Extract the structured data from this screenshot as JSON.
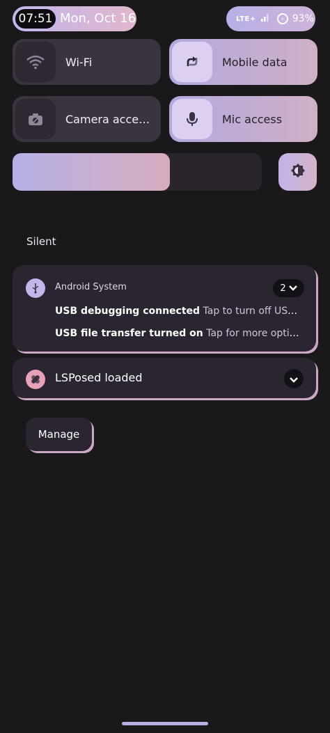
{
  "status_bar": {
    "time": "07:51",
    "date": "Mon, Oct 16",
    "network": "LTE+",
    "battery": "93%"
  },
  "tiles": {
    "wifi": {
      "label": "Wi-Fi",
      "icon": "wifi-icon",
      "active": false
    },
    "mobile_data": {
      "label": "Mobile data",
      "icon": "mobile-data-icon",
      "active": true
    },
    "camera_access": {
      "label": "Camera acce…",
      "icon": "camera-icon",
      "active": false
    },
    "mic_access": {
      "label": "Mic access",
      "icon": "mic-icon",
      "active": true
    }
  },
  "brightness": {
    "level": 0.63,
    "auto_icon": "brightness-auto-icon"
  },
  "section": {
    "title": "Silent"
  },
  "notifications": [
    {
      "app": "Android System",
      "count": "2",
      "icon": "usb-icon",
      "icon_color": "#c3b6ea",
      "lines": [
        {
          "title": "USB debugging connected",
          "text": "Tap to turn off USB deb…"
        },
        {
          "title": "USB file transfer turned on",
          "text": "Tap for more options."
        }
      ]
    },
    {
      "title": "LSPosed loaded",
      "icon": "lsposed-icon",
      "icon_color": "#e7a2b8"
    }
  ],
  "manage_button": {
    "label": "Manage"
  },
  "colors": {
    "accent_start": "#b9b1e6",
    "accent_end": "#d4b2c4",
    "background": "#1b181c"
  }
}
